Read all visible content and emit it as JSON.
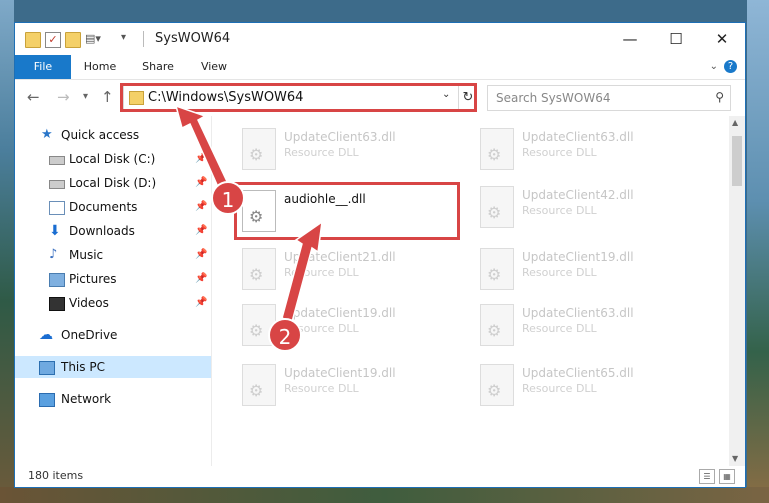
{
  "window": {
    "title": "SysWOW64",
    "minimize": "—",
    "maximize": "☐",
    "close": "✕"
  },
  "ribbon": {
    "tabs": [
      "File",
      "Home",
      "Share",
      "View"
    ],
    "help": "?"
  },
  "nav": {
    "address": "C:\\Windows\\SysWOW64",
    "search_placeholder": "Search SysWOW64"
  },
  "sidebar": {
    "items": [
      {
        "label": "Quick access",
        "icon": "star-icon"
      },
      {
        "label": "Local Disk (C:)",
        "icon": "disk-icon",
        "pinned": true
      },
      {
        "label": "Local Disk (D:)",
        "icon": "disk-icon",
        "pinned": true
      },
      {
        "label": "Documents",
        "icon": "documents-icon",
        "pinned": true
      },
      {
        "label": "Downloads",
        "icon": "downloads-icon",
        "pinned": true
      },
      {
        "label": "Music",
        "icon": "music-icon",
        "pinned": true
      },
      {
        "label": "Pictures",
        "icon": "pictures-icon",
        "pinned": true
      },
      {
        "label": "Videos",
        "icon": "videos-icon",
        "pinned": true
      },
      {
        "label": "OneDrive",
        "icon": "onedrive-icon"
      },
      {
        "label": "This PC",
        "icon": "this-pc-icon",
        "selected": true
      },
      {
        "label": "Network",
        "icon": "network-icon"
      }
    ]
  },
  "files": {
    "left": [
      {
        "name": "UpdateClient63.dll",
        "desc": "Resource DLL"
      },
      {
        "name": "audiohle__.dll",
        "desc": "",
        "active": true
      },
      {
        "name": "UpdateClient21.dll",
        "desc": "Resource DLL"
      },
      {
        "name": "UpdateClient19.dll",
        "desc": "Resource DLL"
      },
      {
        "name": "UpdateClient19.dll",
        "desc": "Resource DLL"
      }
    ],
    "right": [
      {
        "name": "UpdateClient63.dll",
        "desc": "Resource DLL"
      },
      {
        "name": "UpdateClient42.dll",
        "desc": "Resource DLL"
      },
      {
        "name": "UpdateClient19.dll",
        "desc": "Resource DLL"
      },
      {
        "name": "UpdateClient63.dll",
        "desc": "Resource DLL"
      },
      {
        "name": "UpdateClient65.dll",
        "desc": "Resource DLL"
      }
    ]
  },
  "status": {
    "items": "180 items"
  },
  "annotations": {
    "badge1": "1",
    "badge2": "2",
    "color": "#d84545"
  }
}
